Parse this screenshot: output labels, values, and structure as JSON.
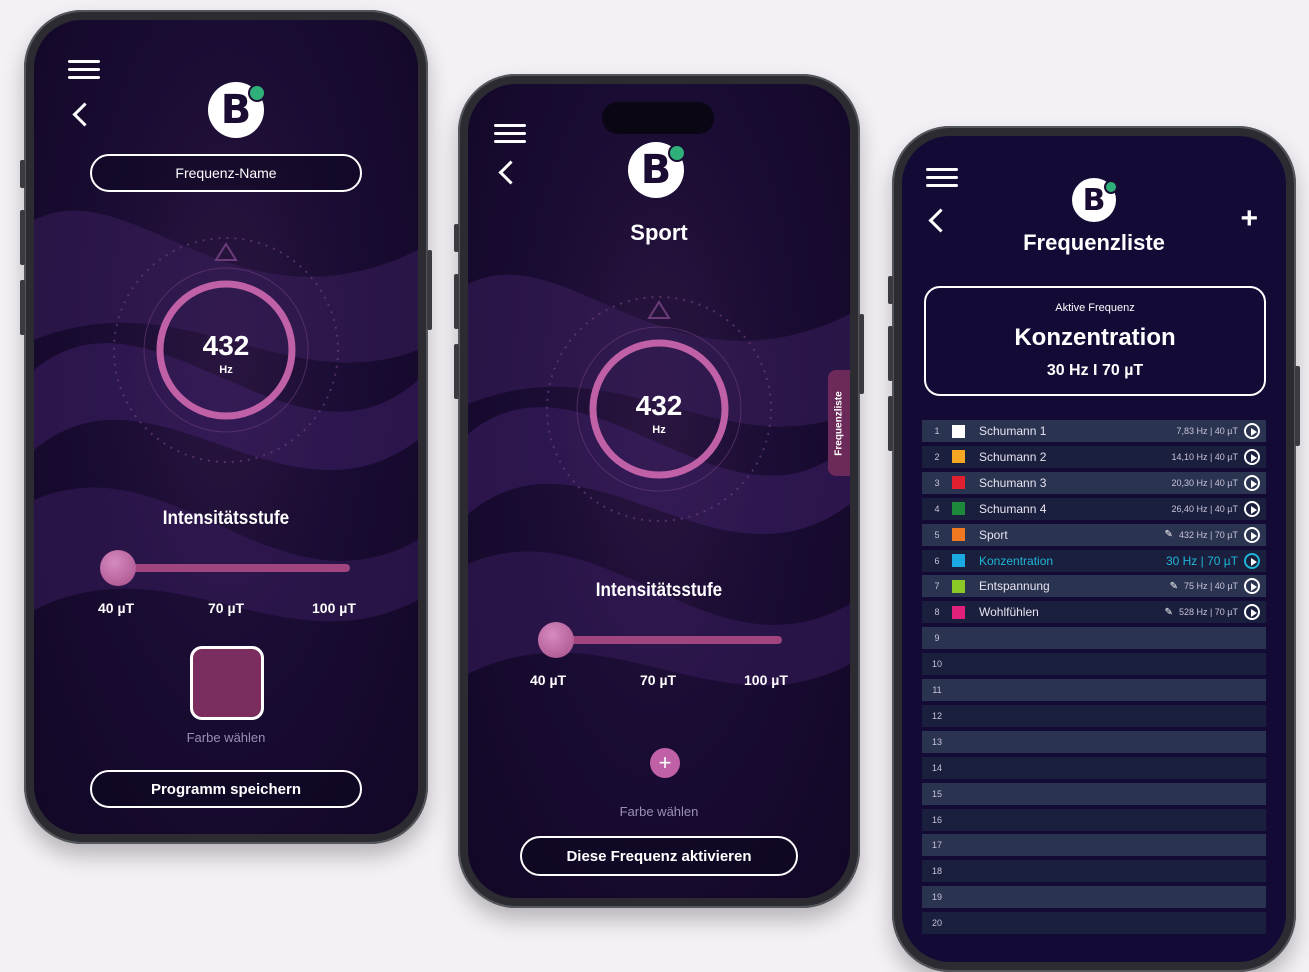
{
  "phone1": {
    "name_field": "Frequenz-Name",
    "frequency": "432",
    "unit": "Hz",
    "intensity_title": "Intensitätsstufe",
    "ticks": [
      "40 µT",
      "70 µT",
      "100 µT"
    ],
    "slider_value_fraction": 0.0,
    "color_label": "Farbe wählen",
    "save_button": "Programm speichern",
    "swatch_color": "#7a2d5e"
  },
  "phone2": {
    "title": "Sport",
    "frequency": "432",
    "unit": "Hz",
    "intensity_title": "Intensitätsstufe",
    "ticks": [
      "40 µT",
      "70 µT",
      "100 µT"
    ],
    "slider_value_fraction": 0.0,
    "color_label": "Farbe wählen",
    "activate_button": "Diese Frequenz aktivieren",
    "side_tab": "Frequenzliste"
  },
  "phone3": {
    "title": "Frequenzliste",
    "active_label": "Aktive Frequenz",
    "active_name": "Konzentration",
    "active_values": "30 Hz I 70 µT",
    "rows": [
      {
        "num": "1",
        "name": "Schumann 1",
        "val": "7,83 Hz | 40 µT",
        "color": "#ffffff",
        "edit": false,
        "active": false
      },
      {
        "num": "2",
        "name": "Schumann 2",
        "val": "14,10 Hz | 40 µT",
        "color": "#f5a623",
        "edit": false,
        "active": false
      },
      {
        "num": "3",
        "name": "Schumann 3",
        "val": "20,30 Hz | 40 µT",
        "color": "#e0202f",
        "edit": false,
        "active": false
      },
      {
        "num": "4",
        "name": "Schumann 4",
        "val": "26,40 Hz | 40 µT",
        "color": "#1c8a3a",
        "edit": false,
        "active": false
      },
      {
        "num": "5",
        "name": "Sport",
        "val": "432 Hz | 70 µT",
        "color": "#f07820",
        "edit": true,
        "active": false
      },
      {
        "num": "6",
        "name": "Konzentration",
        "val": "30 Hz | 70 µT",
        "color": "#1aa9e0",
        "edit": false,
        "active": true
      },
      {
        "num": "7",
        "name": "Entspannung",
        "val": "75 Hz | 40 µT",
        "color": "#8ac926",
        "edit": true,
        "active": false
      },
      {
        "num": "8",
        "name": "Wohlfühlen",
        "val": "528 Hz | 70 µT",
        "color": "#e0207a",
        "edit": true,
        "active": false
      },
      {
        "num": "9"
      },
      {
        "num": "10"
      },
      {
        "num": "11"
      },
      {
        "num": "12"
      },
      {
        "num": "13"
      },
      {
        "num": "14"
      },
      {
        "num": "15"
      },
      {
        "num": "16"
      },
      {
        "num": "17"
      },
      {
        "num": "18"
      },
      {
        "num": "19"
      },
      {
        "num": "20"
      }
    ]
  },
  "colors": {
    "accent": "#c061a8",
    "row_dark": "#2a3350",
    "row_light": "#1a1f3d",
    "active_text": "#1fb6d8"
  }
}
